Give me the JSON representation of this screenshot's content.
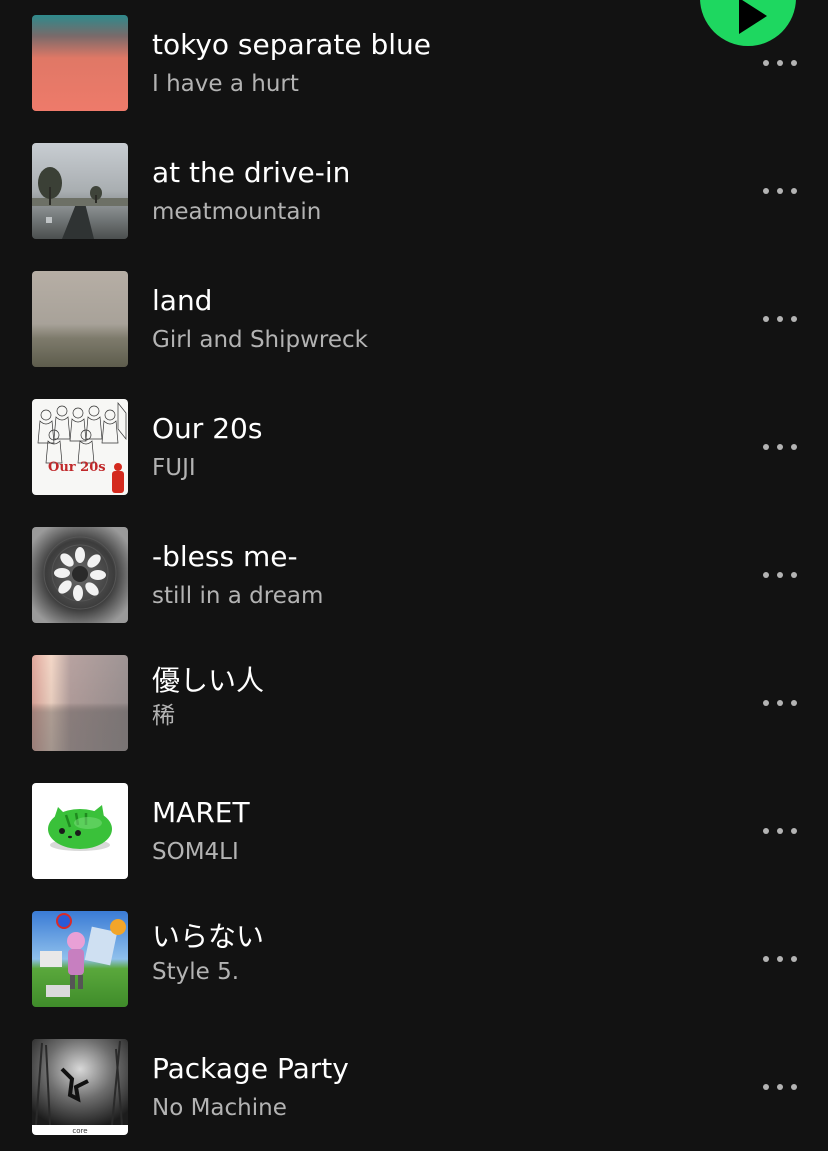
{
  "tracks": [
    {
      "title": "tokyo separate blue",
      "artist": "I have a hurt",
      "cover_icon": "cover-art-salmon-haze"
    },
    {
      "title": "at the drive-in",
      "artist": "meatmountain",
      "cover_icon": "cover-art-rainy-road"
    },
    {
      "title": "land",
      "artist": "Girl and Shipwreck",
      "cover_icon": "cover-art-foggy-field"
    },
    {
      "title": "Our 20s",
      "artist": "FUJI",
      "cover_icon": "cover-art-sketch-figures",
      "cover_text": "Our 20s"
    },
    {
      "title": "-bless me-",
      "artist": "still in a dream",
      "cover_icon": "cover-art-flower-ring"
    },
    {
      "title": "優しい人",
      "artist": "稀",
      "cover_icon": "cover-art-blurred-light"
    },
    {
      "title": "MARET",
      "artist": "SOM4LI",
      "cover_icon": "cover-art-green-cat"
    },
    {
      "title": "いらない",
      "artist": "Style 5.",
      "cover_icon": "cover-art-collage"
    },
    {
      "title": "Package Party",
      "artist": "No Machine",
      "cover_icon": "cover-art-forest-diver",
      "cover_text": "core"
    }
  ],
  "colors": {
    "background": "#121212",
    "title": "#ffffff",
    "subtitle": "#b3b3b3",
    "accent": "#1ed760"
  },
  "play_button": {
    "icon": "play-icon"
  },
  "more_button": {
    "icon": "more-options-icon"
  }
}
